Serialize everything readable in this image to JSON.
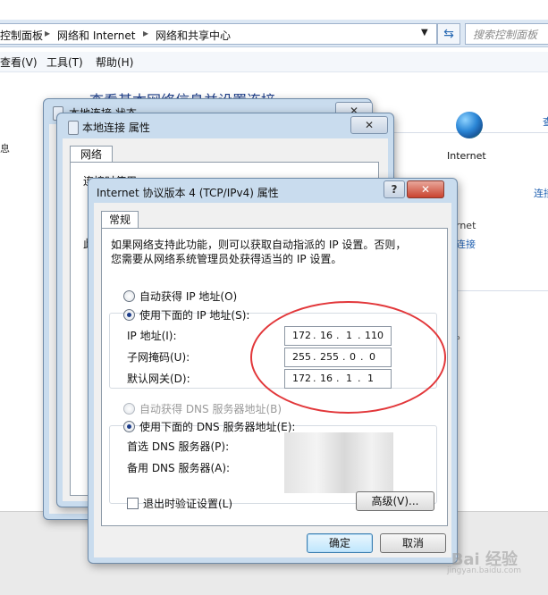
{
  "explorer": {
    "breadcrumb": [
      "控制面板",
      "网络和 Internet",
      "网络和共享中心"
    ],
    "search_placeholder": "搜索控制面板",
    "menu": [
      "查看(V)",
      "工具(T)",
      "帮助(H)"
    ],
    "heading": "查看基本网络信息并设置连接",
    "internet_label": "Internet",
    "link_fragments": [
      "查",
      "连接",
      "rnet",
      "连接"
    ],
    "left_fragment": "息",
    "ie_period": "。"
  },
  "status_window": {
    "title": "本地连接 状态"
  },
  "properties_window": {
    "title": "本地连接 属性",
    "tab": "网络",
    "connect_using": "连接时使用:",
    "frag_left": "此"
  },
  "ipv4_dialog": {
    "title": "Internet 协议版本 4 (TCP/IPv4) 属性",
    "help": "?",
    "close": "✕",
    "tab_general": "常规",
    "description_line1": "如果网络支持此功能，则可以获取自动指派的 IP 设置。否则，",
    "description_line2": "您需要从网络系统管理员处获得适当的 IP 设置。",
    "radio_auto_ip": "自动获得 IP 地址(O)",
    "radio_manual_ip": "使用下面的 IP 地址(S):",
    "ip_address_label": "IP 地址(I):",
    "ip_address": [
      "172",
      "16",
      "1",
      "110"
    ],
    "subnet_label": "子网掩码(U):",
    "subnet_mask": [
      "255",
      "255",
      "0",
      "0"
    ],
    "gateway_label": "默认网关(D):",
    "gateway": [
      "172",
      "16",
      "1",
      "1"
    ],
    "radio_auto_dns": "自动获得 DNS 服务器地址(B)",
    "radio_manual_dns": "使用下面的 DNS 服务器地址(E):",
    "preferred_dns_label": "首选 DNS 服务器(P):",
    "alternate_dns_label": "备用 DNS 服务器(A):",
    "validate_checkbox": "退出时验证设置(L)",
    "advanced_button": "高级(V)...",
    "ok_button": "确定",
    "cancel_button": "取消"
  },
  "watermark": {
    "main": "Bai 经验",
    "sub": "jingyan.baidu.com"
  },
  "colors": {
    "highlight_ellipse": "#e2373a",
    "link_blue": "#1f5fb0",
    "title_blue": "#1e3f8a"
  }
}
